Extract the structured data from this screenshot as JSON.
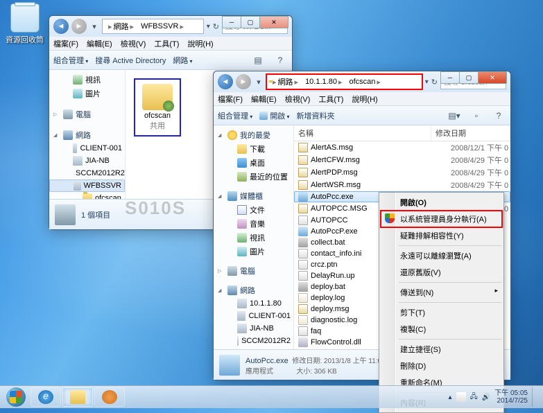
{
  "desktop": {
    "recycle_bin": "資源回收筒"
  },
  "watermark": "S010S",
  "win1": {
    "crumb1": "網路",
    "crumb2": "WFBSSVR",
    "search_ph": "搜尋 WFBS...",
    "menu": {
      "file": "檔案(F)",
      "edit": "編輯(E)",
      "view": "檢視(V)",
      "tools": "工具(T)",
      "help": "說明(H)"
    },
    "tb": {
      "org": "組合管理",
      "ad": "搜尋 Active Directory",
      "net": "網路"
    },
    "nav": {
      "video": "視訊",
      "pic": "圖片",
      "comp": "電腦",
      "net": "網路",
      "h1": "CLIENT-001",
      "h2": "JIA-NB",
      "h3": "SCCM2012R2",
      "h4": "WFBSSVR",
      "sub": "ofcscan"
    },
    "folder": {
      "name": "ofcscan",
      "share": "共用"
    },
    "status": "1 個項目"
  },
  "win2": {
    "crumb1": "網路",
    "crumb2": "10.1.1.80",
    "crumb3": "ofcscan",
    "search_ph": "搜尋 ofcscan",
    "menu": {
      "file": "檔案(F)",
      "edit": "編輯(E)",
      "view": "檢視(V)",
      "tools": "工具(T)",
      "help": "說明(H)"
    },
    "tb": {
      "org": "組合管理",
      "open": "開啟",
      "new": "新增資料夾"
    },
    "nav": {
      "fav": "我的最愛",
      "dl": "下載",
      "desk": "桌面",
      "recent": "最近的位置",
      "lib": "媒體櫃",
      "doc": "文件",
      "mus": "音樂",
      "vid": "視訊",
      "pic": "圖片",
      "comp": "電腦",
      "net": "網路",
      "h1": "10.1.1.80",
      "h2": "CLIENT-001",
      "h3": "JIA-NB",
      "h4": "SCCM2012R2"
    },
    "hdr": {
      "name": "名稱",
      "date": "修改日期"
    },
    "files": [
      {
        "n": "AlertAS.msg",
        "d": "2008/12/1 下午 0",
        "t": "msg"
      },
      {
        "n": "AlertCFW.msg",
        "d": "2008/4/29 下午 0",
        "t": "msg"
      },
      {
        "n": "AlertPDP.msg",
        "d": "2008/4/29 下午 0",
        "t": "msg"
      },
      {
        "n": "AlertWSR.msg",
        "d": "2008/4/29 下午 0",
        "t": "msg"
      },
      {
        "n": "AutoPcc.exe",
        "d": "",
        "t": "exe",
        "sel": true
      },
      {
        "n": "AUTOPCC.MSG",
        "d": "2008/4/29 下午 0",
        "t": "msg"
      },
      {
        "n": "AUTOPCC",
        "d": "",
        "t": "ini"
      },
      {
        "n": "AutoPccP.exe",
        "d": "",
        "t": "exe"
      },
      {
        "n": "collect.bat",
        "d": "",
        "t": "bat"
      },
      {
        "n": "contact_info.ini",
        "d": "",
        "t": "ini"
      },
      {
        "n": "crcz.ptn",
        "d": "",
        "t": "ini"
      },
      {
        "n": "DelayRun.up",
        "d": "",
        "t": "ini"
      },
      {
        "n": "deploy.bat",
        "d": "",
        "t": "bat"
      },
      {
        "n": "deploy.log",
        "d": "",
        "t": "log"
      },
      {
        "n": "deploy.msg",
        "d": "",
        "t": "msg"
      },
      {
        "n": "diagnostic.log",
        "d": "",
        "t": "log"
      },
      {
        "n": "faq",
        "d": "",
        "t": "ini"
      },
      {
        "n": "FlowControl.dll",
        "d": "",
        "t": "dll"
      }
    ],
    "details": {
      "name": "AutoPcc.exe",
      "type": "應用程式",
      "mod_l": "修改日期:",
      "mod_v": "2013/1/8 上午 11:02",
      "size_l": "大小:",
      "size_v": "306 KB"
    }
  },
  "ctx": {
    "open": "開啟(O)",
    "runas": "以系統管理員身分執行(A)",
    "compat": "疑難排解相容性(Y)",
    "offline": "永遠可以離線瀏覽(A)",
    "restore": "還原舊版(V)",
    "sendto": "傳送到(N)",
    "cut": "剪下(T)",
    "copy": "複製(C)",
    "shortcut": "建立捷徑(S)",
    "delete": "刪除(D)",
    "rename": "重新命名(M)",
    "props": "內容(R)"
  },
  "tray": {
    "time": "下午 05:05",
    "date": "2014/7/25"
  }
}
